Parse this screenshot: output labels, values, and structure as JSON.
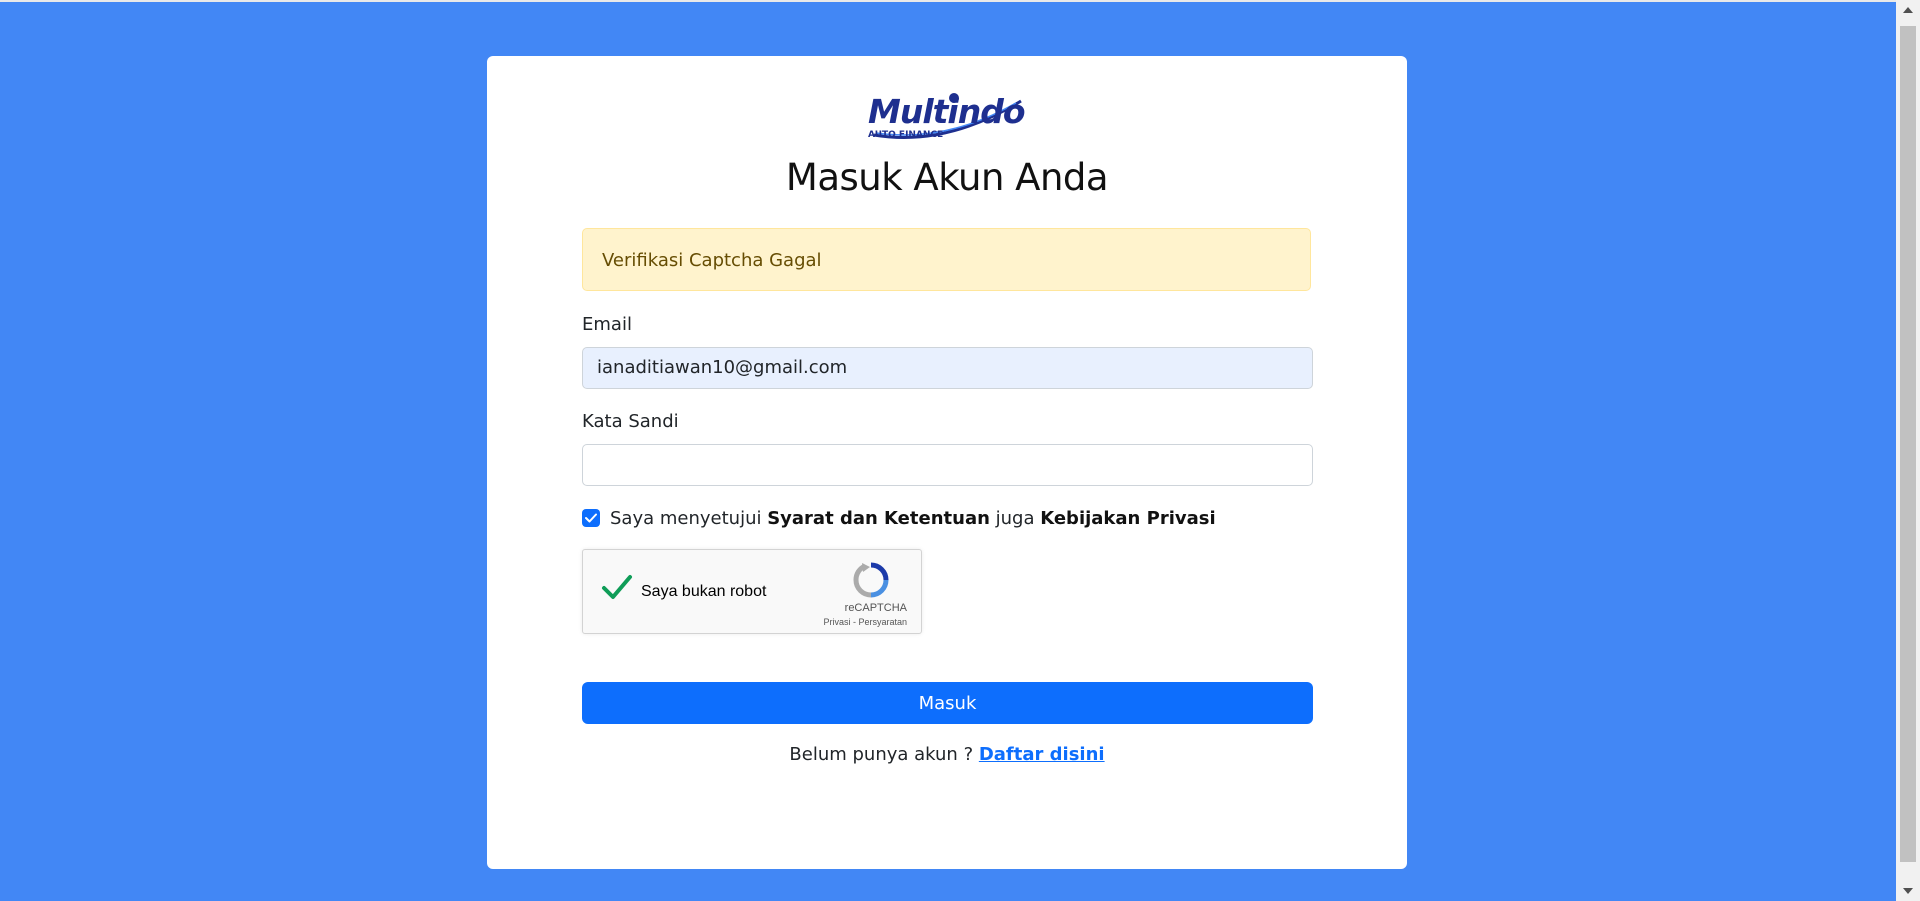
{
  "logo": {
    "text": "Multindo",
    "subtext": "AUTO FINANCE"
  },
  "title": "Masuk Akun Anda",
  "alert": {
    "message": "Verifikasi Captcha Gagal"
  },
  "form": {
    "email_label": "Email",
    "email_value": "ianaditiawan10@gmail.com",
    "password_label": "Kata Sandi",
    "password_value": "",
    "agree": {
      "checked": true,
      "prefix": "Saya menyetujui ",
      "terms_link": "Syarat dan Ketentuan",
      "middle": " juga ",
      "privacy_link": "Kebijakan Privasi"
    },
    "submit_label": "Masuk"
  },
  "recaptcha": {
    "label": "Saya bukan robot",
    "brand": "reCAPTCHA",
    "links": "Privasi - Persyaratan",
    "verified": true
  },
  "register": {
    "prompt": "Belum punya akun ? ",
    "link": "Daftar disini"
  },
  "colors": {
    "background": "#4287f5",
    "primary": "#0d6efd",
    "alert_bg": "#fff3cd",
    "alert_text": "#664d03",
    "logo_blue": "#1e2f8f",
    "check_green": "#0f9d58"
  }
}
